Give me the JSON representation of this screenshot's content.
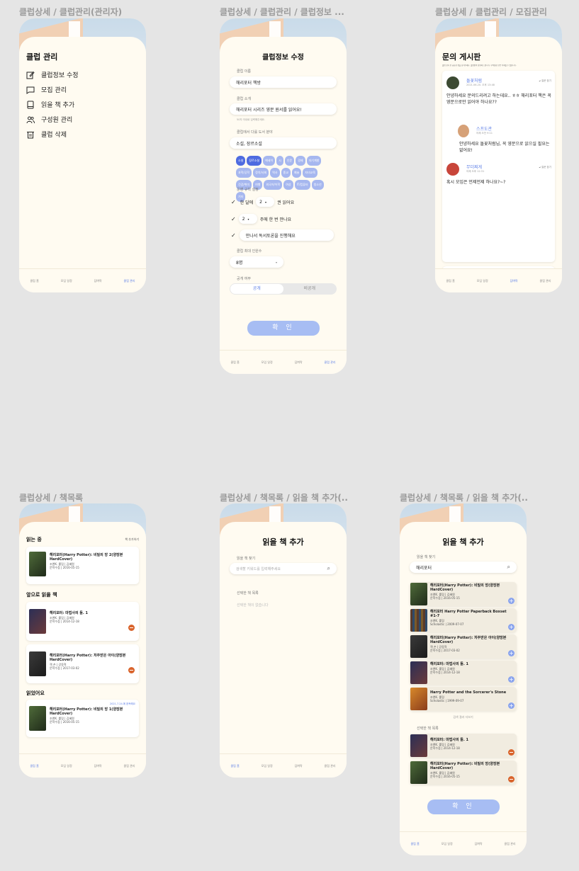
{
  "frames": [
    {
      "title": "클럽상세 / 클럽관리(관리자)"
    },
    {
      "title": "클럽상세 / 클럽관리 / 클럽정보 ..."
    },
    {
      "title": "클럽상세 / 클럽관리 / 모집관리"
    },
    {
      "title": "클럽상세 / 책목록"
    },
    {
      "title": "클럽상세 / 책목록 / 읽을 책 추가(..."
    },
    {
      "title": "클럽상세 / 책목록 / 읽을 책 추가(..."
    }
  ],
  "tabs": [
    "클럽 홈",
    "모임 일정",
    "담벼락",
    "클럽 관리"
  ],
  "admin": {
    "title": "클럽 관리",
    "items": [
      "클럽정보 수정",
      "모집 관리",
      "읽을 책 추가",
      "구성원 관리",
      "클럽 삭제"
    ]
  },
  "edit": {
    "title": "클럽정보 수정",
    "name_label": "클럽 이름",
    "name_value": "해리포터 책방",
    "intro_label": "클럽 소개",
    "intro_value": "해리포터 시리즈 영문 원서를 읽어요!",
    "intro_hint": "50자 이내로 입력해주세요.",
    "genre_label": "클럽에서 다룰 도서 분야",
    "genre_value": "소설, 장르소설",
    "chips": [
      "소설",
      "장르소설",
      "에세이",
      "시",
      "인문",
      "경제",
      "자기계발",
      "과학/공학",
      "정치/사회",
      "역사",
      "종교",
      "예술",
      "자녀교육",
      "건강/취미",
      "여행",
      "외국어/어학",
      "여성",
      "IT/컴퓨터",
      "청소년",
      "기타"
    ],
    "rules_label": "운영 규칙 설정",
    "rule1_pre": "한 달에",
    "rule1_num": "2",
    "rule1_post": "권 읽어요",
    "rule2_num": "2",
    "rule2_post": "주에 한 번 만나요",
    "rule3": "만나서 독서토론을 진행해요",
    "max_label": "클럽 최대 인원수",
    "max_value": "8명",
    "public_label": "공개 여부",
    "public_on": "공개",
    "public_off": "비공개",
    "confirm": "확 인"
  },
  "board": {
    "title": "문의 게시판",
    "desc": "클럽 참가 전 궁금한 점을 남겨주세요. 클럽장이 답변해 드립니다. 부적절한 글은 삭제될 수 있습니다.",
    "posts": [
      {
        "user": "돌꽃처럼",
        "time": "2021.06.20. 오후 13:48",
        "lock": "질문 잠기",
        "text": "안녕하세요 문의드리려고 하는데요.. ㅎㅎ 해리포터 책은 꼭 영문으로만 읽어야 하나요??"
      },
      {
        "user": "스프도관",
        "time": "어제 오전 9:11",
        "text": "안녕하세요 돌꽃처럼님, 꼭 영문으로 읽으실 필요는 없어요!"
      },
      {
        "user": "무더찌게",
        "time": "어제 오후 12:31",
        "lock": "질문 잠기",
        "text": "혹시 모임은 언제언제 하나요?~?"
      }
    ]
  },
  "books": {
    "reading_label": "읽는 중",
    "edit_link": "책 추가하기",
    "reading": [
      {
        "title": "해리포터(Harry Potter): 비밀의 방 2(양장본 HardCover)",
        "author": "조앤K. 롤링 | 김혜원",
        "pub": "문학수첩 | 2016-05-15"
      }
    ],
    "next_label": "앞으로 읽을 책",
    "next": [
      {
        "title": "해리포터: 마법사의 돌. 1",
        "author": "조앤K. 롤링 | 김혜원",
        "pub": "문학수첩 | 2014-12-18"
      },
      {
        "title": "해리포터(Harry Potter): 저주받은 아이(양장본 HardCover)",
        "author": "잭 손 | 강동혁",
        "pub": "문학수첩 | 2017-03-02"
      }
    ],
    "done_label": "읽었어요",
    "done_date": "2021.7.24.에 완독해요",
    "done": [
      {
        "title": "해리포터(Harry Potter): 비밀의 방 1(양장본 HardCover)",
        "author": "조앤K. 롤링 | 김혜원",
        "pub": "문학수첩 | 2016-05-15"
      }
    ]
  },
  "addbook": {
    "title": "읽을 책 추가",
    "search_label": "읽을 책 찾기",
    "search_placeholder": "검색할 키워드를 입력해주세요",
    "selected_label": "선택한 책 목록",
    "empty": "선택한 책이 없습니다"
  },
  "addbook2": {
    "title": "읽을 책 추가",
    "search_label": "읽을 책 찾기",
    "search_value": "해리포터",
    "results": [
      {
        "title": "해리포터(Harry Potter): 비밀의 방(양장본 HardCover)",
        "author": "조앤K. 롤링 | 김혜원",
        "pub": "문학수첩 | 2016-05-15"
      },
      {
        "title": "해리포터 Harry Potter Paperback Boxset #1-7",
        "author": "조앤K. 롤링",
        "pub": "Scholastic | 2009-07-07"
      },
      {
        "title": "해리포터(Harry Potter): 저주받은 아이(양장본 HardCover)",
        "author": "잭 손 | 강동혁",
        "pub": "문학수첩 | 2017-03-02"
      },
      {
        "title": "해리포터: 마법사의 돌. 1",
        "author": "조앤K. 롤링 | 김혜원",
        "pub": "문학수첩 | 2014-12-18"
      },
      {
        "title": "Harry Potter and the Sorcerer's Stone",
        "author": "조앤K. 롤링",
        "pub": "Scholastic | 1999-09-07"
      }
    ],
    "more": "검색 결과 더보기",
    "selected_label": "선택한 책 목록",
    "selected": [
      {
        "title": "해리포터: 마법사의 돌. 1",
        "author": "조앤K. 롤링 | 김혜원",
        "pub": "문학수첩 | 2014-12-18"
      },
      {
        "title": "해리포터(Harry Potter): 비밀의 방(양장본 HardCover)",
        "author": "조앤K. 롤링 | 김혜원",
        "pub": "문학수첩 | 2016-05-15"
      }
    ],
    "confirm": "확 인"
  }
}
